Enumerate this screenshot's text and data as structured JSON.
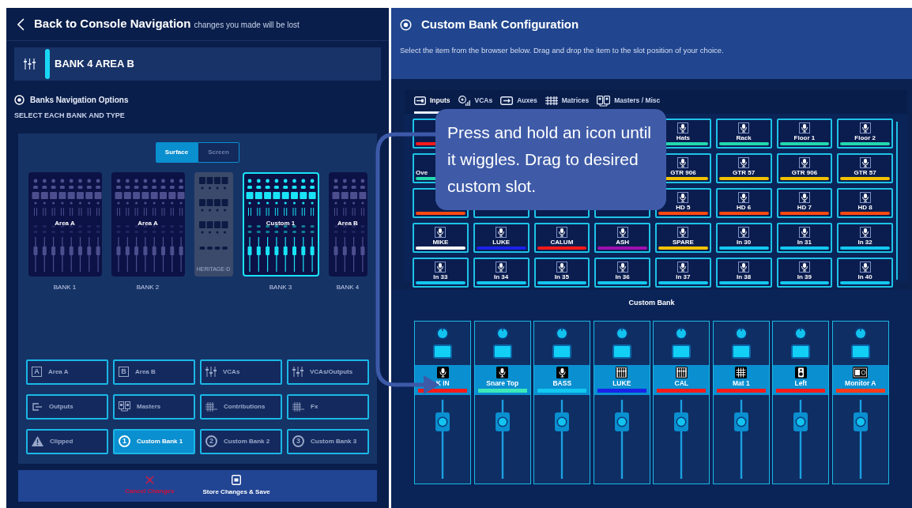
{
  "header": {
    "back_title": "Back to Console Navigation",
    "note": "changes you made will be lost"
  },
  "bank_bar": {
    "label": "BANK 4 AREA B"
  },
  "nav_options": {
    "title": "Banks Navigation Options",
    "subtitle": "SELECT EACH BANK AND TYPE"
  },
  "view_toggle": [
    {
      "label": "Surface",
      "selected": true
    },
    {
      "label": "Screen",
      "selected": false
    }
  ],
  "banks": [
    {
      "kind": "full",
      "area": "Area A",
      "caption": "BANK 1",
      "selected": false
    },
    {
      "kind": "full",
      "area": "Area A",
      "caption": "BANK 2",
      "selected": false
    },
    {
      "kind": "logo",
      "logo": "HERITAGE·D"
    },
    {
      "kind": "full",
      "area": "Custom 1",
      "caption": "BANK 3",
      "selected": true
    },
    {
      "kind": "half",
      "area": "Area B",
      "caption": "BANK 4",
      "selected": false
    }
  ],
  "bank_types": [
    {
      "label": "Area A",
      "kind": "letter",
      "badge": "A",
      "selected": false
    },
    {
      "label": "Area B",
      "kind": "letter",
      "badge": "B",
      "selected": false
    },
    {
      "label": "VCAs",
      "kind": "sliders",
      "selected": false
    },
    {
      "label": "VCAs/Outputs",
      "kind": "sliders",
      "selected": false
    },
    {
      "label": "Outputs",
      "kind": "output",
      "selected": false
    },
    {
      "label": "Masters",
      "kind": "masters",
      "selected": false
    },
    {
      "label": "Contributions",
      "kind": "grid",
      "selected": false
    },
    {
      "label": "Fx",
      "kind": "grid",
      "selected": false
    },
    {
      "label": "Clipped",
      "kind": "warning",
      "selected": false
    },
    {
      "label": "Custom Bank 1",
      "kind": "number",
      "badge": "1",
      "selected": true
    },
    {
      "label": "Custom Bank 2",
      "kind": "number",
      "badge": "2",
      "selected": false
    },
    {
      "label": "Custom Bank 3",
      "kind": "number",
      "badge": "3",
      "selected": false
    }
  ],
  "actions": [
    {
      "kind": "cancel",
      "label": "Cancel Changes"
    },
    {
      "kind": "save",
      "label": "Store Changes & Save"
    }
  ],
  "config": {
    "title": "Custom Bank Configuration",
    "instructions": "Select the item from the browser below. Drag and drop the item to the slot position of your choice."
  },
  "browser_tabs": [
    {
      "label": "Inputs",
      "kind": "input",
      "selected": true
    },
    {
      "label": "VCAs",
      "kind": "vca",
      "selected": false
    },
    {
      "label": "Auxes",
      "kind": "aux",
      "selected": false
    },
    {
      "label": "Matrices",
      "kind": "matrix",
      "selected": false
    },
    {
      "label": "Masters / Misc",
      "kind": "masters",
      "selected": false
    }
  ],
  "browser_tiles": [
    {
      "kind": "covered",
      "color": "#ff1a1a"
    },
    {
      "kind": "under"
    },
    {
      "kind": "under"
    },
    {
      "kind": "under"
    },
    {
      "kind": "full",
      "label": "Hats",
      "color": "#22d8b0"
    },
    {
      "kind": "full",
      "label": "Rack",
      "color": "#22d8b0"
    },
    {
      "kind": "full",
      "label": "Floor 1",
      "color": "#22d8b0"
    },
    {
      "kind": "full",
      "label": "Floor 2",
      "color": "#22d8b0"
    },
    {
      "kind": "partial",
      "label": "Ove",
      "color": "#22d8b0"
    },
    {
      "kind": "under"
    },
    {
      "kind": "hidden"
    },
    {
      "kind": "hidden"
    },
    {
      "kind": "full",
      "label": "GTR 906",
      "color": "#f2c200"
    },
    {
      "kind": "full",
      "label": "GTR 57",
      "color": "#f2c200"
    },
    {
      "kind": "full",
      "label": "GTR 906",
      "color": "#f2c200"
    },
    {
      "kind": "full",
      "label": "GTR 57",
      "color": "#f2c200"
    },
    {
      "kind": "covered",
      "color": "#ff4a10"
    },
    {
      "kind": "hidden"
    },
    {
      "kind": "hidden"
    },
    {
      "kind": "hidden"
    },
    {
      "kind": "full",
      "label": "HD  5",
      "color": "#ff4a10"
    },
    {
      "kind": "full",
      "label": "HD  6",
      "color": "#ff4a10"
    },
    {
      "kind": "full",
      "label": "HD  7",
      "color": "#ff4a10"
    },
    {
      "kind": "full",
      "label": "HD  8",
      "color": "#ff4a10"
    },
    {
      "kind": "full",
      "label": "MIKE",
      "color": "#ffffff"
    },
    {
      "kind": "full",
      "label": "LUKE",
      "color": "#1a22e8"
    },
    {
      "kind": "full",
      "label": "CALUM",
      "color": "#ff1a1a"
    },
    {
      "kind": "full",
      "label": "ASH",
      "color": "#a010b0"
    },
    {
      "kind": "full",
      "label": "SPARE",
      "color": "#f2c200"
    },
    {
      "kind": "full",
      "label": "In 30",
      "color": "#12c8f0"
    },
    {
      "kind": "full",
      "label": "In 31",
      "color": "#12c8f0"
    },
    {
      "kind": "full",
      "label": "In 32",
      "color": "#12c8f0"
    },
    {
      "kind": "full",
      "label": "In 33",
      "color": "#12c8f0"
    },
    {
      "kind": "full",
      "label": "In 34",
      "color": "#12c8f0"
    },
    {
      "kind": "full",
      "label": "In 35",
      "color": "#12c8f0"
    },
    {
      "kind": "full",
      "label": "In 36",
      "color": "#12c8f0"
    },
    {
      "kind": "full",
      "label": "In 37",
      "color": "#12c8f0"
    },
    {
      "kind": "full",
      "label": "In 38",
      "color": "#12c8f0"
    },
    {
      "kind": "full",
      "label": "In 39",
      "color": "#12c8f0"
    },
    {
      "kind": "full",
      "label": "In 40",
      "color": "#12c8f0"
    }
  ],
  "tooltip": {
    "text": "Press and hold an icon until it wiggles. Drag to desired custom slot."
  },
  "custom_bank": {
    "title": "Custom Bank",
    "strips": [
      {
        "label": "K IN",
        "kind": "mic",
        "color": "#ff1a1a"
      },
      {
        "label": "Snare Top",
        "kind": "mic",
        "color": "#3ee8b8"
      },
      {
        "label": "BASS",
        "kind": "mic",
        "color": "#12c8f0"
      },
      {
        "label": "LUKE",
        "kind": "vca",
        "color": "#1a22e8"
      },
      {
        "label": "CAL",
        "kind": "vca",
        "color": "#ff1a1a"
      },
      {
        "label": "Mat 1",
        "kind": "matrix",
        "color": "#ff1a1a"
      },
      {
        "label": "Left",
        "kind": "speaker",
        "color": "#ff1a1a"
      },
      {
        "label": "Monitor A",
        "kind": "monitor",
        "color": "#ff3a1a"
      }
    ]
  }
}
